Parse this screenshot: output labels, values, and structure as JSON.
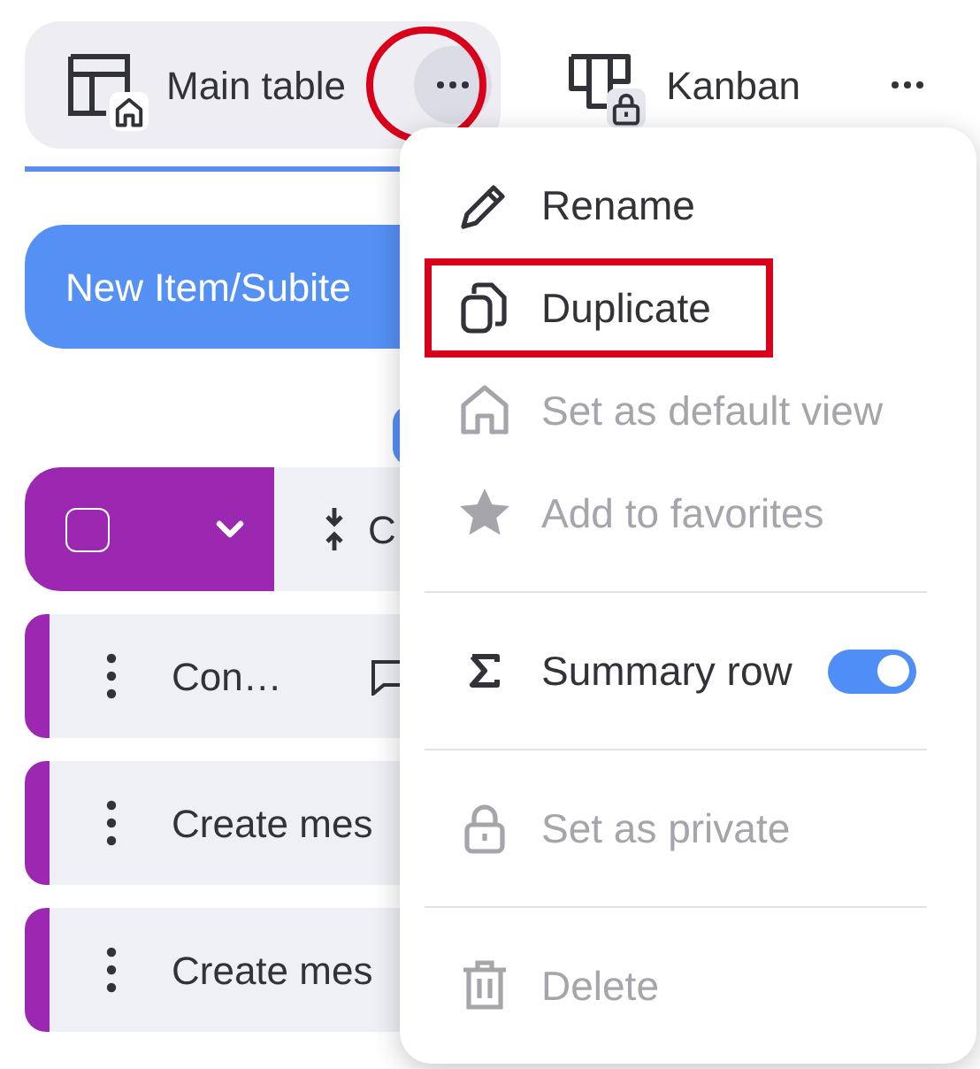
{
  "tabs": [
    {
      "label": "Main table",
      "selected": true,
      "menu_annotated": true
    },
    {
      "label": "Kanban",
      "selected": false,
      "menu_annotated": false
    }
  ],
  "new_item_button": {
    "label": "New Item/Subite"
  },
  "table_header": {
    "checked": false,
    "column_1": "C"
  },
  "rows": [
    {
      "name": "Con…",
      "has_comment": true
    },
    {
      "name": "Create mes",
      "has_comment": false
    },
    {
      "name": "Create mes",
      "has_comment": false
    }
  ],
  "menu": {
    "sections": [
      [
        {
          "kind": "action",
          "label": "Rename",
          "disabled": false,
          "annotated": false
        },
        {
          "kind": "action",
          "label": "Duplicate",
          "disabled": false,
          "annotated": true
        },
        {
          "kind": "action",
          "label": "Set as default view",
          "disabled": true,
          "annotated": false
        },
        {
          "kind": "action",
          "label": "Add to favorites",
          "disabled": true,
          "annotated": false
        }
      ],
      [
        {
          "kind": "toggle",
          "label": "Summary row",
          "disabled": false,
          "on": true,
          "annotated": false
        }
      ],
      [
        {
          "kind": "action",
          "label": "Set as private",
          "disabled": true,
          "annotated": false
        }
      ],
      [
        {
          "kind": "action",
          "label": "Delete",
          "disabled": true,
          "annotated": false
        }
      ]
    ]
  }
}
